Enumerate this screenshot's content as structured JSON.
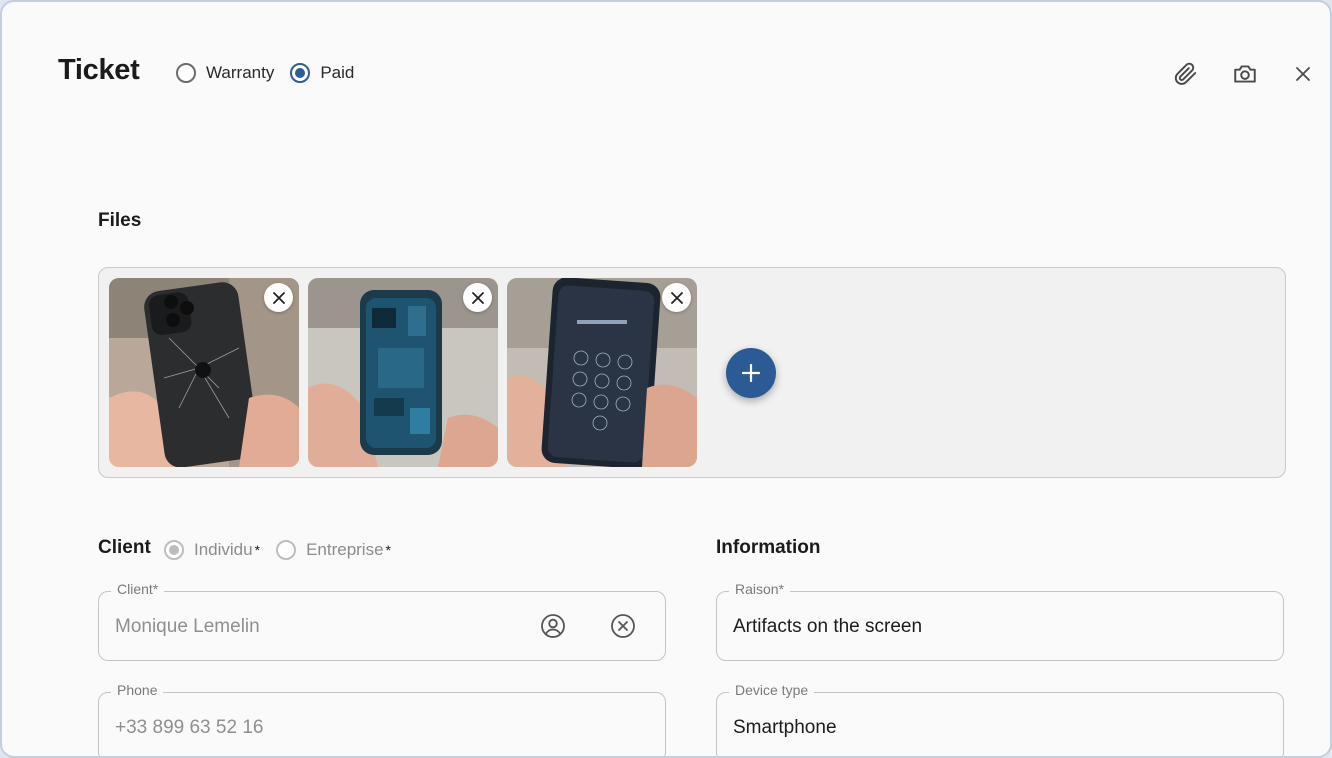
{
  "header": {
    "title": "Ticket",
    "ticket_types": [
      {
        "label": "Warranty",
        "selected": false
      },
      {
        "label": "Paid",
        "selected": true
      }
    ],
    "icons": [
      "paperclip-icon",
      "camera-icon",
      "close-icon"
    ]
  },
  "files": {
    "title": "Files",
    "items": [
      {
        "name": "cracked-back-phone-photo"
      },
      {
        "name": "open-phone-internals-photo"
      },
      {
        "name": "lockscreen-keypad-photo"
      }
    ],
    "add_icon": "plus-icon"
  },
  "client": {
    "title": "Client",
    "types": [
      {
        "label": "Individu",
        "required": "*",
        "selected": true
      },
      {
        "label": "Entreprise",
        "required": "*",
        "selected": false
      }
    ],
    "client_field": {
      "label": "Client*",
      "value": "Monique Lemelin"
    },
    "phone_field": {
      "label": "Phone",
      "value": "+33 899 63 52 16"
    }
  },
  "information": {
    "title": "Information",
    "reason_field": {
      "label": "Raison*",
      "value": "Artifacts on the screen"
    },
    "device_field": {
      "label": "Device type",
      "value": "Smartphone"
    }
  },
  "colors": {
    "accent": "#2b5a95",
    "border": "#c4c4c4",
    "background": "#fafafa"
  }
}
